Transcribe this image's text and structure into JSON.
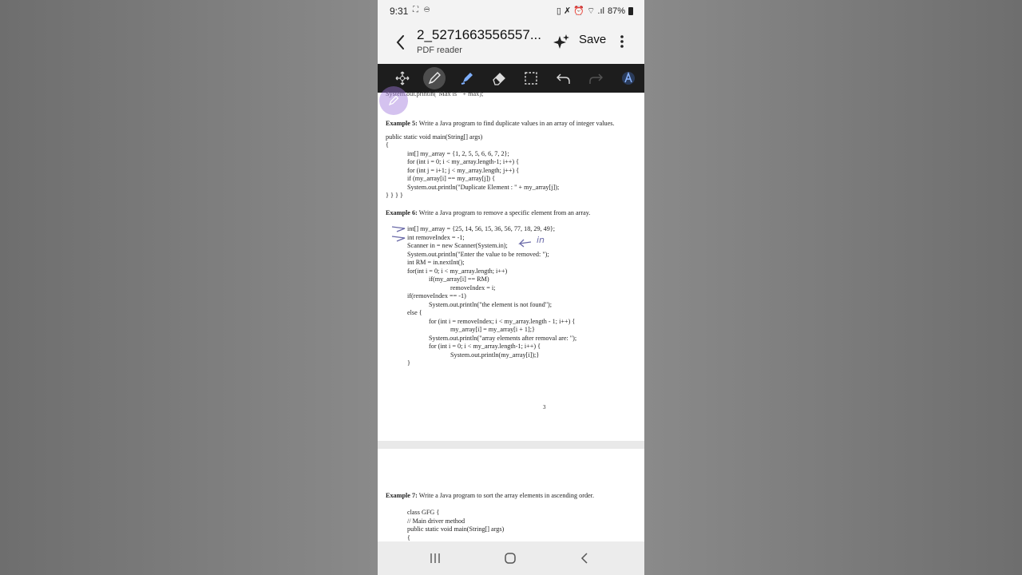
{
  "status_bar": {
    "time": "9:31",
    "left_icons": "⛶ ⊖",
    "right_icons": "▯ ✗ ⏰ ⌔ .ıl",
    "battery": "87%"
  },
  "header": {
    "title": "2_5271663556557...",
    "subtitle": "PDF reader",
    "save_label": "Save"
  },
  "toolbar": {
    "tools": [
      "move-select",
      "pen",
      "highlighter",
      "eraser",
      "lasso-select",
      "undo",
      "redo",
      "ai-pen"
    ],
    "active_tool": "pen",
    "active_color": "#4d4d4d"
  },
  "page1": {
    "top_cut_line": "System.out.println(\"Max is \" + max);",
    "ex5_label": "Example 5:",
    "ex5_text": " Write a Java program to find duplicate values in an array of integer values.",
    "ex5_code": [
      "public static void main(String[] args)",
      "{",
      "int[] my_array = {1, 2, 5, 5, 6, 6, 7, 2};",
      "for (int i = 0; i < my_array.length-1; i++) {",
      "for (int j = i+1; j < my_array.length; j++) {",
      "if (my_array[i] == my_array[j]) {",
      "System.out.println(\"Duplicate Element : \" + my_array[j]);",
      "} } } }"
    ],
    "ex6_label": "Example 6:",
    "ex6_text": " Write a Java program to remove a specific element from an array.",
    "ex6_code": [
      "int[] my_array = {25, 14, 56, 15, 36, 56, 77, 18, 29, 49};",
      "int removeIndex = -1;",
      "Scanner in = new Scanner(System.in);",
      "System.out.println(\"Enter the value to be removed: \");",
      "int RM = in.nextInt();",
      "for(int i = 0; i < my_array.length; i++)",
      "if(my_array[i] == RM)",
      "removeIndex = i;",
      "if(removeIndex == -1)",
      "System.out.println(\"the element is not found\");",
      "else {",
      "for (int i = removeIndex; i < my_array.length - 1; i++) {",
      "my_array[i] = my_array[i + 1];}",
      "System.out.println(\"array elements after removal are: \");",
      "for (int i = 0; i < my_array.length-1; i++) {",
      "System.out.println(my_array[i]);}",
      "}"
    ],
    "handwritten_note": "in",
    "page_number": "3"
  },
  "page2": {
    "ex7_label": "Example 7:",
    "ex7_text": " Write a Java program to sort the array elements in ascending order.",
    "ex7_code": [
      "class GFG {",
      "// Main driver method",
      "public static void main(String[] args)",
      "{"
    ]
  },
  "nav": {
    "recents": "|||",
    "home": "○",
    "back": "‹"
  }
}
